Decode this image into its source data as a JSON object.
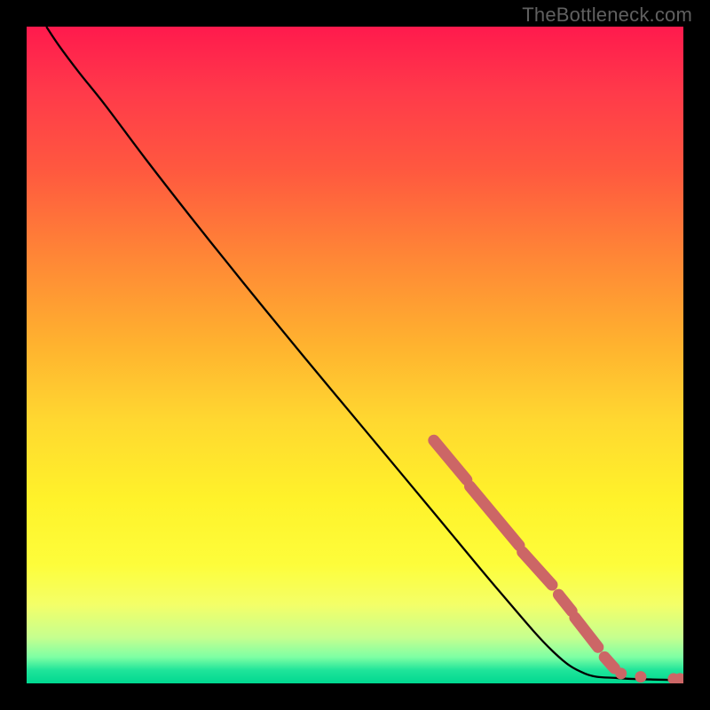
{
  "watermark": "TheBottleneck.com",
  "chart_data": {
    "type": "line",
    "title": "",
    "xlabel": "",
    "ylabel": "",
    "xlim": [
      0,
      100
    ],
    "ylim": [
      0,
      100
    ],
    "curve": [
      {
        "x": 3,
        "y": 100
      },
      {
        "x": 5,
        "y": 97
      },
      {
        "x": 8,
        "y": 93
      },
      {
        "x": 12,
        "y": 88
      },
      {
        "x": 18,
        "y": 80
      },
      {
        "x": 25,
        "y": 71
      },
      {
        "x": 33,
        "y": 61
      },
      {
        "x": 42,
        "y": 50
      },
      {
        "x": 52,
        "y": 38
      },
      {
        "x": 62,
        "y": 26
      },
      {
        "x": 72,
        "y": 14
      },
      {
        "x": 80,
        "y": 5
      },
      {
        "x": 85,
        "y": 1.5
      },
      {
        "x": 90,
        "y": 0.8
      },
      {
        "x": 95,
        "y": 0.6
      },
      {
        "x": 100,
        "y": 0.5
      }
    ],
    "highlight_segments": [
      {
        "x1": 62,
        "y1": 37,
        "x2": 67,
        "y2": 31
      },
      {
        "x1": 67.5,
        "y1": 30,
        "x2": 75,
        "y2": 21
      },
      {
        "x1": 75.5,
        "y1": 20,
        "x2": 80,
        "y2": 15
      },
      {
        "x1": 81,
        "y1": 13.5,
        "x2": 83,
        "y2": 11
      },
      {
        "x1": 83.5,
        "y1": 10,
        "x2": 87,
        "y2": 5.5
      },
      {
        "x1": 88,
        "y1": 4,
        "x2": 89.5,
        "y2": 2.3
      }
    ],
    "highlight_points": [
      {
        "x": 90.5,
        "y": 1.5
      },
      {
        "x": 93.5,
        "y": 1.0
      },
      {
        "x": 98.5,
        "y": 0.7
      },
      {
        "x": 99.5,
        "y": 0.7
      }
    ],
    "highlight_color": "#cc6666"
  }
}
